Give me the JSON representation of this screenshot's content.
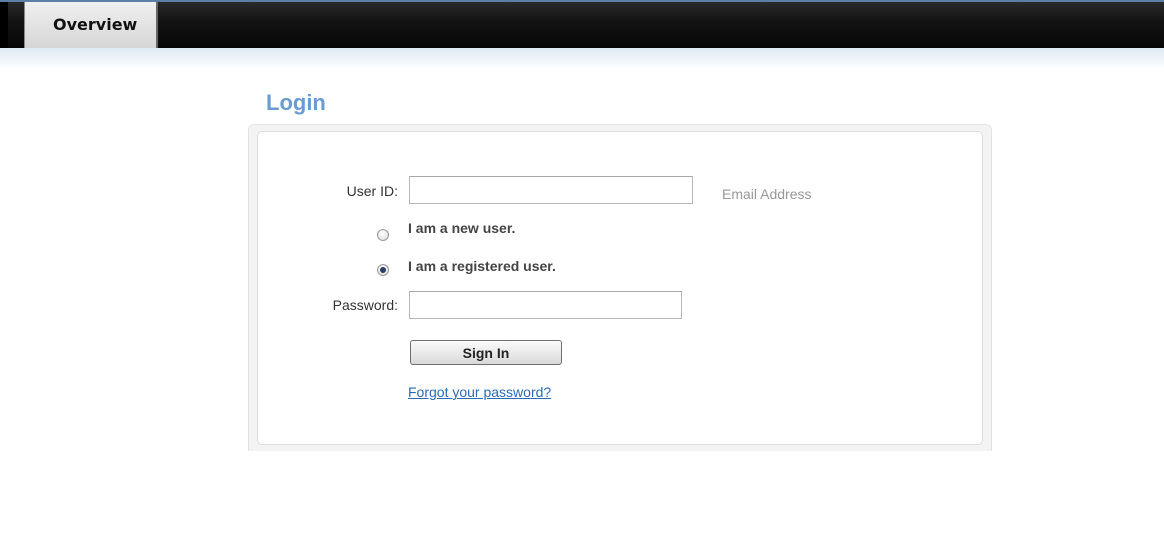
{
  "nav": {
    "tabs": [
      {
        "label": "Overview",
        "active": true
      }
    ]
  },
  "login": {
    "title": "Login",
    "userid_label": "User ID:",
    "userid_value": "",
    "userid_hint": "Email Address",
    "radio_new_label": "I am a new user.",
    "radio_registered_label": "I am a registered user.",
    "selected_option": "registered",
    "password_label": "Password:",
    "password_value": "",
    "signin_label": "Sign In",
    "forgot_link": "Forgot your password?"
  },
  "colors": {
    "title_blue": "#6a9bd1",
    "link_blue": "#2a6bb8",
    "topbar_dark": "#0a0a0a"
  }
}
